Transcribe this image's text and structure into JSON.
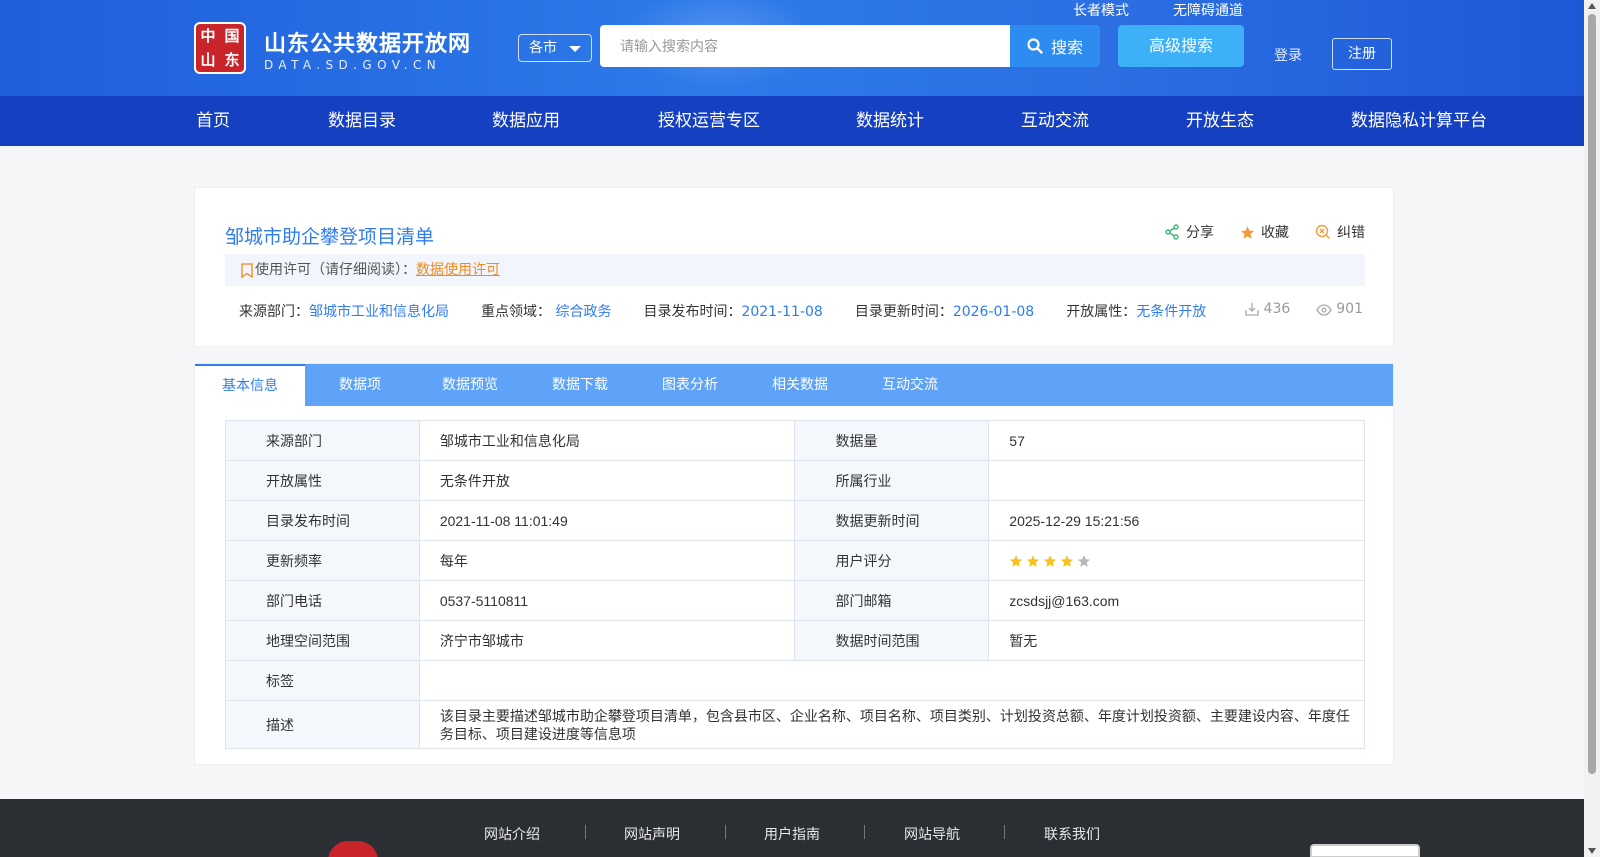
{
  "header": {
    "logo_seal": [
      "中",
      "国",
      "山",
      "东"
    ],
    "site_title": "山东公共数据开放网",
    "site_domain": "DATA.SD.GOV.CN",
    "city_select": "各市",
    "search_placeholder": "请输入搜索内容",
    "search_label": "搜索",
    "advanced_search_label": "高级搜索",
    "elder_mode": "长者模式",
    "accessibility": "无障碍通道",
    "login": "登录",
    "register": "注册",
    "colors": {
      "header_bg": "#2b6fe3",
      "nav_bg": "#1640c2",
      "accent": "#2f7df0",
      "license": "#f08a1c"
    }
  },
  "nav": {
    "items": [
      "首页",
      "数据目录",
      "数据应用",
      "授权运营专区",
      "数据统计",
      "互动交流",
      "开放生态",
      "数据隐私计算平台"
    ]
  },
  "dataset": {
    "title": "邹城市助企攀登项目清单",
    "actions": {
      "share": "分享",
      "favorite": "收藏",
      "report": "纠错"
    },
    "license_prefix": "使用许可（请仔细阅读）：",
    "license_link": "数据使用许可",
    "meta": {
      "source_label": "来源部门：",
      "source_value": "邹城市工业和信息化局",
      "domain_label": "重点领域：",
      "domain_value": "综合政务",
      "published_label": "目录发布时间：",
      "published_value": "2021-11-08",
      "updated_label": "目录更新时间：",
      "updated_value": "2026-01-08",
      "open_label": "开放属性：",
      "open_value": "无条件开放"
    },
    "downloads": "436",
    "views": "901"
  },
  "tabs": [
    "基本信息",
    "数据项",
    "数据预览",
    "数据下载",
    "图表分析",
    "相关数据",
    "互动交流"
  ],
  "info_table": {
    "rows": [
      {
        "l1": "来源部门",
        "v1": "邹城市工业和信息化局",
        "l2": "数据量",
        "v2": "57"
      },
      {
        "l1": "开放属性",
        "v1": "无条件开放",
        "l2": "所属行业",
        "v2": ""
      },
      {
        "l1": "目录发布时间",
        "v1": "2021-11-08 11:01:49",
        "l2": "数据更新时间",
        "v2": "2025-12-29 15:21:56"
      },
      {
        "l1": "更新频率",
        "v1": "每年",
        "l2": "用户评分",
        "v2": ""
      },
      {
        "l1": "部门电话",
        "v1": "0537-5110811",
        "l2": "部门邮箱",
        "v2": "zcsdsjj@163.com"
      },
      {
        "l1": "地理空间范围",
        "v1": "济宁市邹城市",
        "l2": "数据时间范围",
        "v2": "暂无"
      }
    ],
    "tags_label": "标签",
    "tags_value": "",
    "desc_label": "描述",
    "desc_value": "该目录主要描述邹城市助企攀登项目清单，包含县市区、企业名称、项目名称、项目类别、计划投资总额、年度计划投资额、主要建设内容、年度任务目标、项目建设进度等信息项",
    "rating": {
      "stars": 4,
      "max": 5,
      "star_color": "#f7c21a",
      "empty_color": "#b7b7b7"
    }
  },
  "footer": {
    "links": [
      "网站介绍",
      "网站声明",
      "用户指南",
      "网站导航",
      "联系我们"
    ]
  }
}
